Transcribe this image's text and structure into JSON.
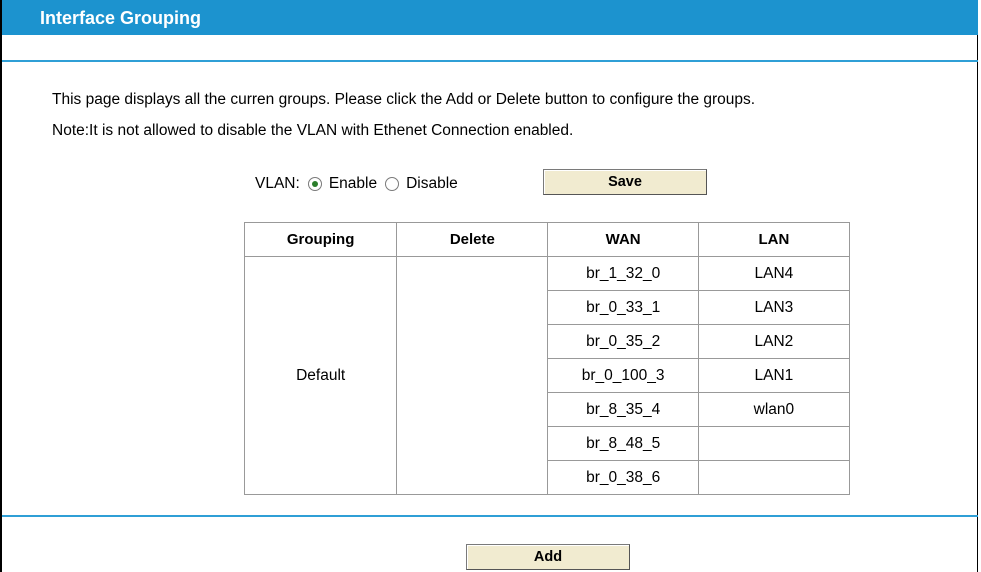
{
  "header": {
    "title": "Interface Grouping"
  },
  "description": {
    "line1": "This page displays all the curren groups. Please click the Add or Delete button to configure the groups.",
    "line2": "Note:It is not allowed to disable the VLAN with Ethenet Connection enabled."
  },
  "vlan": {
    "label": "VLAN:",
    "enable_label": "Enable",
    "disable_label": "Disable",
    "selected": "Enable"
  },
  "buttons": {
    "save_label": "Save",
    "add_label": "Add"
  },
  "table": {
    "headers": [
      "Grouping",
      "Delete",
      "WAN",
      "LAN"
    ],
    "group_name": "Default",
    "delete_value": "",
    "wan": [
      "br_1_32_0",
      "br_0_33_1",
      "br_0_35_2",
      "br_0_100_3",
      "br_8_35_4",
      "br_8_48_5",
      "br_0_38_6"
    ],
    "lan": [
      "LAN4",
      "LAN3",
      "LAN2",
      "LAN1",
      "wlan0",
      "",
      ""
    ]
  },
  "colors": {
    "accent": "#1c93cf",
    "button_bg": "#f1ebd0"
  }
}
